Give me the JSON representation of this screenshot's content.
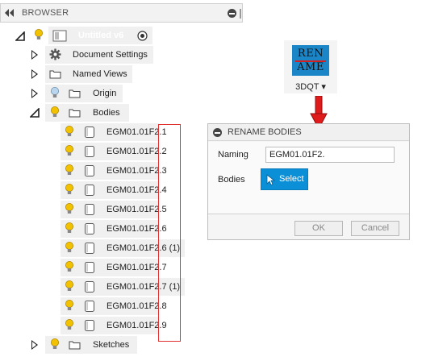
{
  "browser": {
    "title": "BROWSER",
    "root": {
      "label": "Untitled v6"
    },
    "items": [
      {
        "label": "Document Settings"
      },
      {
        "label": "Named Views"
      },
      {
        "label": "Origin"
      },
      {
        "label": "Bodies"
      }
    ],
    "bodies": [
      "EGM01.01F2.1",
      "EGM01.01F2.2",
      "EGM01.01F2.3",
      "EGM01.01F2.4",
      "EGM01.01F2.5",
      "EGM01.01F2.6",
      "EGM01.01F2.6 (1)",
      "EGM01.01F2.7",
      "EGM01.01F2.7 (1)",
      "EGM01.01F2.8",
      "EGM01.01F2.9"
    ],
    "sketches": {
      "label": "Sketches"
    }
  },
  "addin": {
    "line1": "REN",
    "line2": "AME",
    "caption": "3DQT ▾",
    "tile_color": "#1a86c8"
  },
  "dialog": {
    "title": "RENAME BODIES",
    "naming_label": "Naming",
    "naming_value": "EGM01.01F2.",
    "bodies_label": "Bodies",
    "select_label": "Select",
    "ok_label": "OK",
    "cancel_label": "Cancel"
  },
  "colors": {
    "accent": "#0b8fd6",
    "highlight": "#e03030",
    "bulb": "#f2c200"
  }
}
